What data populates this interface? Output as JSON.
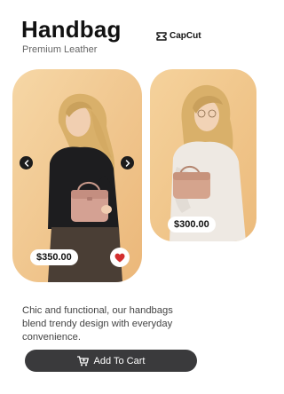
{
  "header": {
    "title": "Handbag",
    "subtitle": "Premium Leather",
    "brand": "CapCut"
  },
  "products": [
    {
      "price": "$350.00",
      "favorited": true
    },
    {
      "price": "$300.00"
    }
  ],
  "description": "Chic and functional, our handbags blend trendy design with everyday convenience.",
  "cta": {
    "label": "Add To Cart"
  },
  "icons": {
    "brand": "capcut-logo-icon",
    "prev": "chevron-left-icon",
    "next": "chevron-right-icon",
    "favorite": "heart-icon",
    "cart": "cart-icon"
  },
  "colors": {
    "accent": "#d32f2f",
    "button": "#3a3a3c",
    "card_background": "#f3cc94"
  }
}
